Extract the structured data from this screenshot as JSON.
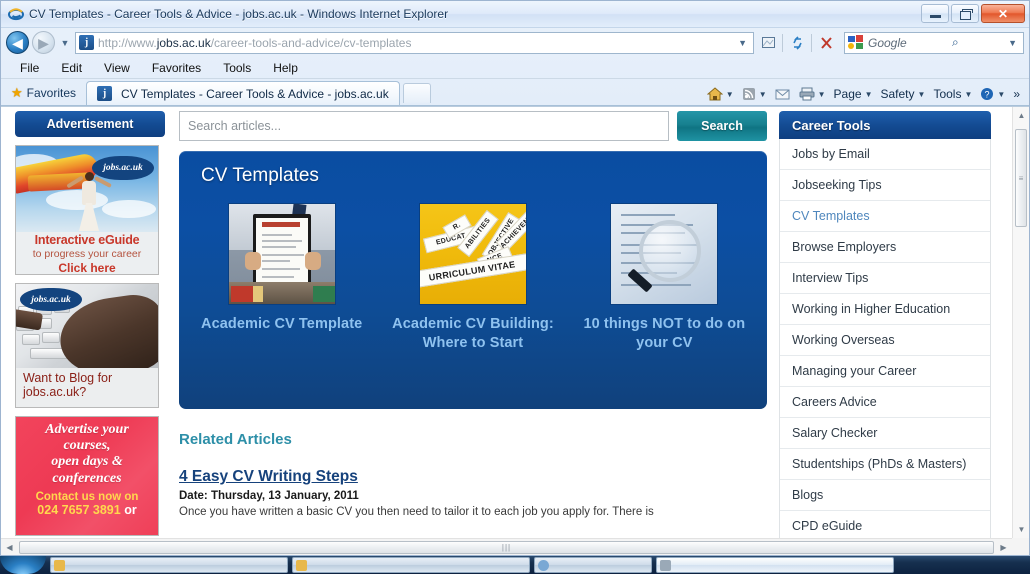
{
  "window": {
    "title": "CV Templates - Career Tools & Advice - jobs.ac.uk - Windows Internet Explorer",
    "minimize_label": "Minimize",
    "restore_label": "Restore",
    "close_label": "✕"
  },
  "address_bar": {
    "back_label": "◀",
    "forward_label": "▶",
    "history_caret": "▼",
    "url_prefix": "http://www.",
    "url_domain": "jobs.ac.uk",
    "url_path": "/career-tools-and-advice/cv-templates",
    "url_caret": "▼",
    "compat_icon": "compatibility-view-icon",
    "refresh_icon": "refresh-icon",
    "stop_icon": "stop-icon",
    "search_provider": "Google",
    "search_go_icon": "magnifier-icon",
    "search_caret": "▼"
  },
  "menu": {
    "items": [
      "File",
      "Edit",
      "View",
      "Favorites",
      "Tools",
      "Help"
    ]
  },
  "tabs": {
    "favorites_label": "Favorites",
    "star_icon": "star-icon",
    "active_tab": "CV Templates - Career Tools & Advice - jobs.ac.uk",
    "new_tab_label": ""
  },
  "command_bar": {
    "home_icon": "home-icon",
    "feeds_icon": "rss-feed-icon",
    "mail_icon": "mail-icon",
    "print_icon": "printer-icon",
    "caret": "▼",
    "page_label": "Page",
    "safety_label": "Safety",
    "tools_label": "Tools",
    "help_icon": "help-icon",
    "overflow": "»"
  },
  "advertisement": {
    "header": "Advertisement",
    "ad1": {
      "brand": "jobs.ac.uk",
      "line1": "Interactive eGuide",
      "line2": "to progress your career",
      "line3": "Click here"
    },
    "ad2": {
      "brand": "jobs.ac.uk",
      "line1": "Want to Blog for",
      "line2": "jobs.ac.uk?"
    },
    "ad3": {
      "line1": "Advertise your",
      "line2": "courses,",
      "line3": "open days &",
      "line4": "conferences",
      "contact1": "Contact us now on",
      "phone": "024 7657 3891",
      "contact_tail": "or"
    }
  },
  "search": {
    "placeholder": "Search articles...",
    "button_label": "Search"
  },
  "hero": {
    "title": "CV Templates",
    "cards": [
      {
        "caption": "Academic CV Template",
        "thumb": "cv-clipboard-photo"
      },
      {
        "caption": "Academic CV Building: Where to Start",
        "thumb": "cv-word-slips-photo"
      },
      {
        "caption": "10 things NOT to do on your CV",
        "thumb": "cv-magnifier-photo"
      }
    ],
    "thumb2_words": [
      "EDUCAT",
      "ABILITIES",
      "OBJECTIVE",
      "R...",
      "ACHIEVEME",
      "NCE",
      "URRICULUM VITAE"
    ]
  },
  "related": {
    "heading": "Related Articles",
    "articles": [
      {
        "title": "4 Easy CV Writing Steps",
        "date": "Date: Thursday, 13 January, 2011",
        "body": "Once you have written a basic CV you then need to tailor it to each job you apply for. There is"
      }
    ]
  },
  "career_tools": {
    "header": "Career Tools",
    "items": [
      {
        "label": "Jobs by Email",
        "active": false
      },
      {
        "label": "Jobseeking Tips",
        "active": false
      },
      {
        "label": "CV Templates",
        "active": true
      },
      {
        "label": "Browse Employers",
        "active": false
      },
      {
        "label": "Interview Tips",
        "active": false
      },
      {
        "label": "Working in Higher Education",
        "active": false
      },
      {
        "label": "Working Overseas",
        "active": false
      },
      {
        "label": "Managing your Career",
        "active": false
      },
      {
        "label": "Careers Advice",
        "active": false
      },
      {
        "label": "Salary Checker",
        "active": false
      },
      {
        "label": "Studentships (PhDs & Masters)",
        "active": false
      },
      {
        "label": "Blogs",
        "active": false
      },
      {
        "label": "CPD eGuide",
        "active": false
      }
    ]
  },
  "scrollbars": {
    "up_arrow": "▲",
    "down_arrow": "▼",
    "left_arrow": "◀",
    "right_arrow": "▶",
    "grip": "|||"
  },
  "colors": {
    "brand_blue": "#0a4da2",
    "header_blue": "#134a91",
    "search_teal": "#17808f",
    "link_blue": "#8fc2ef",
    "related_teal": "#2d8fa8",
    "article_link": "#16427c",
    "ad_red": "#ef3f58"
  }
}
